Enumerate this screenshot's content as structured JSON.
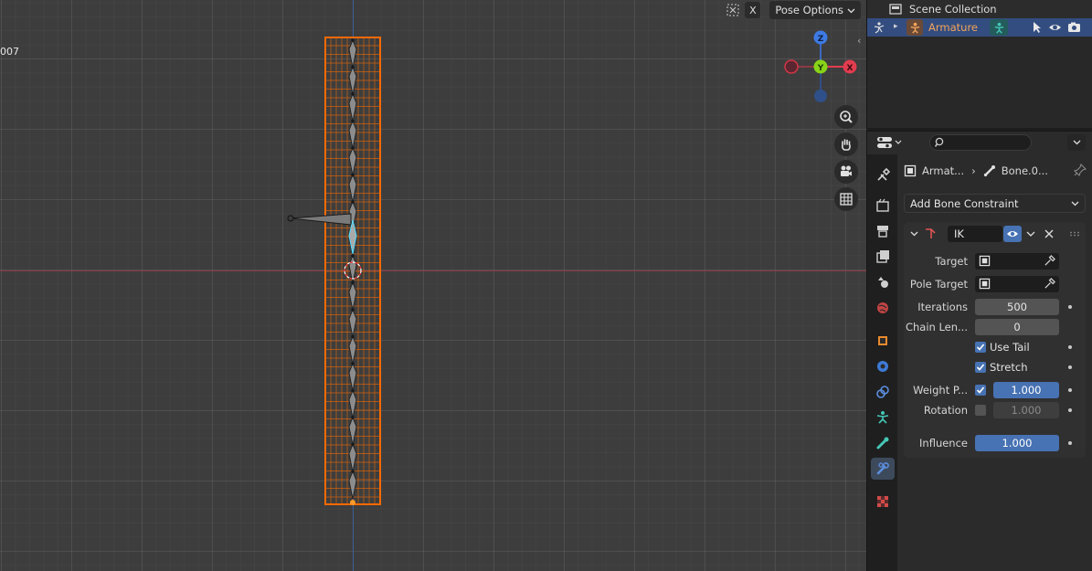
{
  "viewport": {
    "frame_label": "007",
    "close_label": "X",
    "pose_options_label": "Pose Options"
  },
  "gizmo": {
    "z": "Z",
    "y": "Y",
    "x": "X"
  },
  "outliner": {
    "root": "Scene Collection",
    "item": "Armature"
  },
  "properties": {
    "breadcrumb": {
      "object": "Armat...",
      "bone": "Bone.0..."
    },
    "add_constraint": "Add Bone Constraint",
    "constraint": {
      "name": "IK",
      "target_label": "Target",
      "pole_target_label": "Pole Target",
      "iterations_label": "Iterations",
      "iterations": "500",
      "chain_length_label": "Chain Len...",
      "chain_length": "0",
      "use_tail_label": "Use Tail",
      "use_tail": true,
      "stretch_label": "Stretch",
      "stretch": true,
      "weight_position_label": "Weight P...",
      "weight_position": "1.000",
      "weight_position_enabled": true,
      "rotation_label": "Rotation",
      "rotation": "1.000",
      "rotation_enabled": false,
      "influence_label": "Influence",
      "influence": "1.000"
    }
  },
  "colors": {
    "selection_orange": "#ff6a00",
    "active_blue": "#4772b3",
    "outliner_selected": "#334d80",
    "armature_orange": "#f3a45a"
  }
}
